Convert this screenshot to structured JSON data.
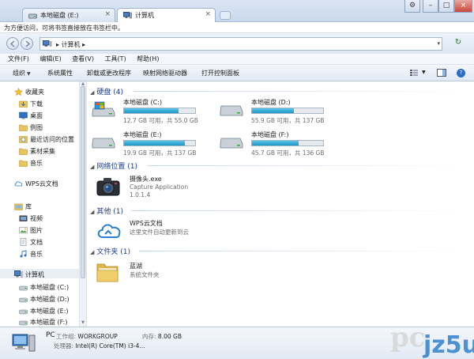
{
  "tabs": [
    {
      "label": "本地磁盘 (E:)",
      "close": "×"
    },
    {
      "label": "计算机",
      "close": "×"
    }
  ],
  "favorites_hint": "为方便访问，可将书签直接放在书签栏中。",
  "address": {
    "crumb": "计算机",
    "sep": "▸"
  },
  "menu": [
    "文件(F)",
    "编辑(E)",
    "查看(V)",
    "工具(T)",
    "帮助(H)"
  ],
  "commands": [
    "组织",
    "系统属性",
    "卸载或更改程序",
    "映射网络驱动器",
    "打开控制面板"
  ],
  "help_glyph": "?",
  "sidebar": {
    "favorites": "收藏夹",
    "fav_items": [
      "下载",
      "桌面",
      "例图",
      "最近访问的位置",
      "素材采集",
      "音乐"
    ],
    "wps": "WPS云文档",
    "library": "库",
    "lib_items": [
      "视频",
      "图片",
      "文档",
      "音乐"
    ],
    "computer": "计算机",
    "drives": [
      "本地磁盘 (C:)",
      "本地磁盘 (D:)",
      "本地磁盘 (E:)",
      "本地磁盘 (F:)"
    ]
  },
  "groups": {
    "hdd": "硬盘 (4)",
    "network": "网络位置 (1)",
    "other": "其他 (1)",
    "folders": "文件夹 (1)"
  },
  "drives": [
    {
      "name": "本地磁盘 (C:)",
      "info": "12.7 GB 可用，共 55.0 GB",
      "used": 0.77
    },
    {
      "name": "本地磁盘 (D:)",
      "info": "55.9 GB 可用，共 137 GB",
      "used": 0.59
    },
    {
      "name": "本地磁盘 (E:)",
      "info": "19.9 GB 可用，共 137 GB",
      "used": 0.85
    },
    {
      "name": "本地磁盘 (F:)",
      "info": "45.7 GB 可用，共 136 GB",
      "used": 0.66
    }
  ],
  "network_item": {
    "name": "摄像头.exe",
    "type": "Capture Application",
    "version": "1.0.1.4"
  },
  "other_item": {
    "name": "WPS云文档",
    "desc": "这里文件自动更新到云"
  },
  "folder_item": {
    "name": "蓝湖",
    "desc": "系统文件夹"
  },
  "details": {
    "name": "PC",
    "workgroup_label": "工作组:",
    "workgroup": "WORKGROUP",
    "memory_label": "内存:",
    "memory": "8.00 GB",
    "cpu_label": "处理器:",
    "cpu": "Intel(R) Core(TM) i3-4..."
  },
  "colors": {
    "accent": "#1e3b8a",
    "bar_fill": "#1a96c8",
    "close_red": "#c9473a"
  }
}
